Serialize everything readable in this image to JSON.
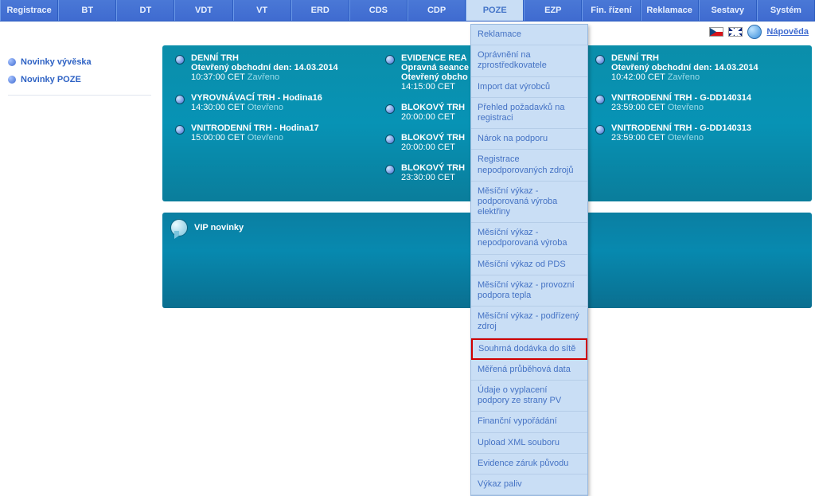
{
  "menubar": [
    {
      "label": "Registrace"
    },
    {
      "label": "BT"
    },
    {
      "label": "DT"
    },
    {
      "label": "VDT"
    },
    {
      "label": "VT"
    },
    {
      "label": "ERD"
    },
    {
      "label": "CDS"
    },
    {
      "label": "CDP"
    },
    {
      "label": "POZE",
      "active": true
    },
    {
      "label": "EZP"
    },
    {
      "label": "Fin. řízení"
    },
    {
      "label": "Reklamace"
    },
    {
      "label": "Sestavy"
    },
    {
      "label": "Systém"
    }
  ],
  "help_label": "Nápověda",
  "sidebar": {
    "links": [
      {
        "label": "Novinky vývěska"
      },
      {
        "label": "Novinky POZE"
      }
    ]
  },
  "news": {
    "cols": [
      {
        "items": [
          {
            "title": "DENNÍ TRH",
            "sub": "Otevřený obchodní den: 14.03.2014",
            "time": "10:37:00 CET",
            "state": "Zavřeno"
          },
          {
            "title": "VYROVNÁVACÍ TRH - Hodina16",
            "sub": "",
            "time": "14:30:00 CET",
            "state": "Otevřeno"
          },
          {
            "title": "VNITRODENNÍ TRH - Hodina17",
            "sub": "",
            "time": "15:00:00 CET",
            "state": "Otevřeno"
          }
        ]
      },
      {
        "items": [
          {
            "title": "EVIDENCE REA",
            "sub": "Opravná seance",
            "subline2": "Otevřený obcho",
            "time": "14:15:00 CET",
            "state": ""
          },
          {
            "title": "BLOKOVÝ TRH",
            "sub": "",
            "time": "20:00:00 CET",
            "state": ""
          },
          {
            "title": "BLOKOVÝ TRH",
            "sub": "",
            "time": "20:00:00 CET",
            "state": ""
          },
          {
            "title": "BLOKOVÝ TRH",
            "sub": "",
            "time": "23:30:00 CET",
            "state": ""
          }
        ]
      },
      {
        "items": [
          {
            "title": "DENNÍ TRH",
            "sub": "Otevřený obchodní den: 14.03.2014",
            "time": "10:42:00 CET",
            "state": "Zavřeno"
          },
          {
            "title": "VNITRODENNÍ TRH - G-DD140314",
            "sub": "",
            "time": "23:59:00 CET",
            "state": "Otevřeno"
          },
          {
            "title": "VNITRODENNÍ TRH - G-DD140313",
            "sub": "",
            "time": "23:59:00 CET",
            "state": "Otevřeno"
          }
        ]
      }
    ]
  },
  "vip_title": "VIP novinky",
  "dropdown": [
    {
      "label": "Reklamace"
    },
    {
      "label": "Oprávnění na zprostředkovatele"
    },
    {
      "label": "Import dat výrobců"
    },
    {
      "label": "Přehled požadavků na registraci"
    },
    {
      "label": "Nárok na podporu"
    },
    {
      "label": "Registrace nepodporovaných zdrojů"
    },
    {
      "label": "Měsíční výkaz - podporovaná výroba elektřiny"
    },
    {
      "label": "Měsíční výkaz - nepodporovaná výroba"
    },
    {
      "label": "Měsíční výkaz od PDS"
    },
    {
      "label": "Měsíční výkaz - provozní podpora tepla"
    },
    {
      "label": "Měsíční výkaz - podřízený zdroj"
    },
    {
      "label": "Souhrná dodávka do sítě",
      "highlight": true
    },
    {
      "label": "Měřená průběhová data"
    },
    {
      "label": "Údaje o vyplacení podpory ze strany PV"
    },
    {
      "label": "Finanční vypořádání"
    },
    {
      "label": "Upload XML souboru"
    },
    {
      "label": "Evidence záruk původu"
    },
    {
      "label": "Výkaz paliv"
    }
  ]
}
